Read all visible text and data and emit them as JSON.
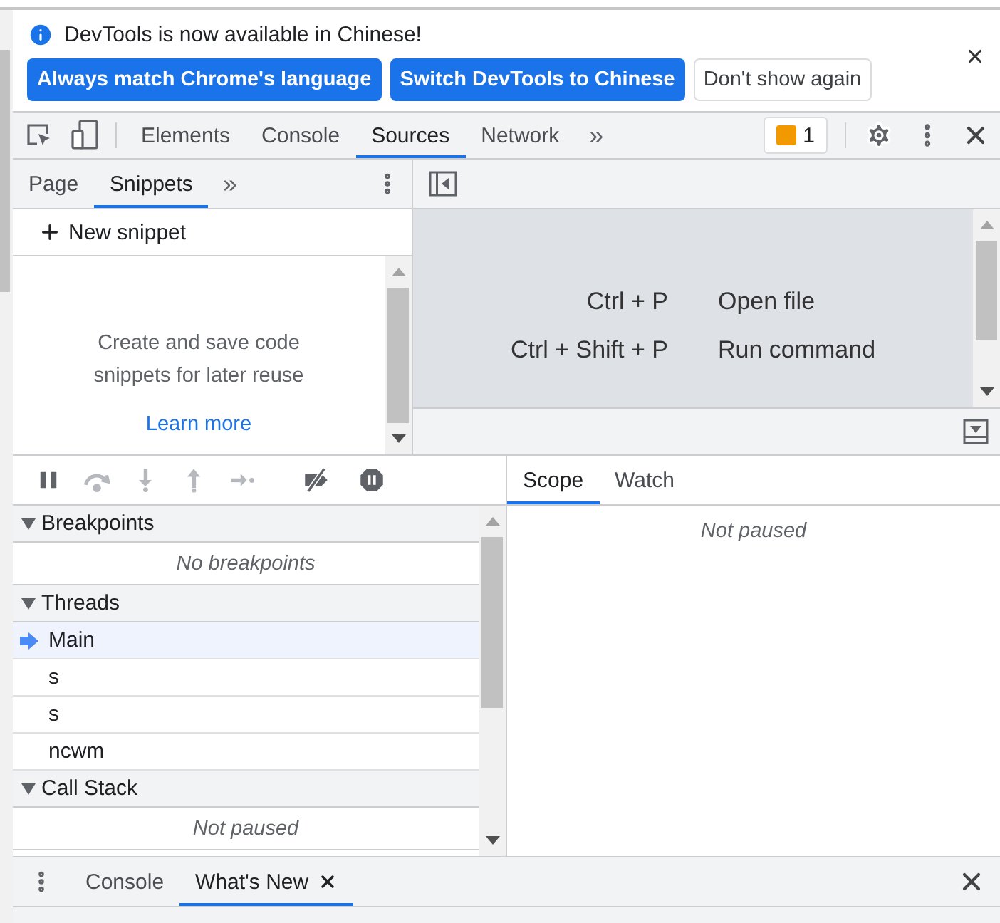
{
  "infobar": {
    "message": "DevTools is now available in Chinese!",
    "buttons": [
      {
        "label": "Always match Chrome's language",
        "kind": "primary"
      },
      {
        "label": "Switch DevTools to Chinese",
        "kind": "primary"
      },
      {
        "label": "Don't show again",
        "kind": "secondary"
      }
    ]
  },
  "main_tabs": [
    {
      "label": "Elements",
      "selected": false
    },
    {
      "label": "Console",
      "selected": false
    },
    {
      "label": "Sources",
      "selected": true
    },
    {
      "label": "Network",
      "selected": false
    }
  ],
  "main_overflow": "»",
  "issues_count": "1",
  "navigator": {
    "tabs": [
      {
        "label": "Page",
        "selected": false
      },
      {
        "label": "Snippets",
        "selected": true
      }
    ],
    "overflow": "»",
    "new_snippet": "New snippet",
    "empty_message": "Create and save code snippets for later reuse",
    "learn_more": "Learn more"
  },
  "editor": {
    "shortcuts": [
      {
        "keys": "Ctrl + P",
        "action": "Open file"
      },
      {
        "keys": "Ctrl + Shift + P",
        "action": "Run command"
      }
    ]
  },
  "debugger": {
    "toolbar": [
      {
        "kind": "pause",
        "disabled": false
      },
      {
        "kind": "step-over",
        "disabled": true
      },
      {
        "kind": "step-into",
        "disabled": true
      },
      {
        "kind": "step-out",
        "disabled": true
      },
      {
        "kind": "step",
        "disabled": true
      },
      {
        "kind": "deactivate",
        "disabled": false
      },
      {
        "kind": "pause-exceptions",
        "disabled": false
      }
    ],
    "sections": [
      {
        "title": "Breakpoints",
        "expanded": true,
        "empty": "No breakpoints"
      },
      {
        "title": "Threads",
        "expanded": true,
        "threads": [
          {
            "name": "Main",
            "selected": true
          },
          {
            "name": "s",
            "selected": false
          },
          {
            "name": "s",
            "selected": false
          },
          {
            "name": "ncwm",
            "selected": false
          }
        ]
      },
      {
        "title": "Call Stack",
        "expanded": true,
        "empty": "Not paused"
      }
    ]
  },
  "sidebar": {
    "tabs": [
      {
        "label": "Scope",
        "selected": true
      },
      {
        "label": "Watch",
        "selected": false
      }
    ],
    "message": "Not paused"
  },
  "drawer": {
    "tabs": [
      {
        "label": "Console",
        "selected": false,
        "closable": false
      },
      {
        "label": "What's New",
        "selected": true,
        "closable": true
      }
    ]
  }
}
